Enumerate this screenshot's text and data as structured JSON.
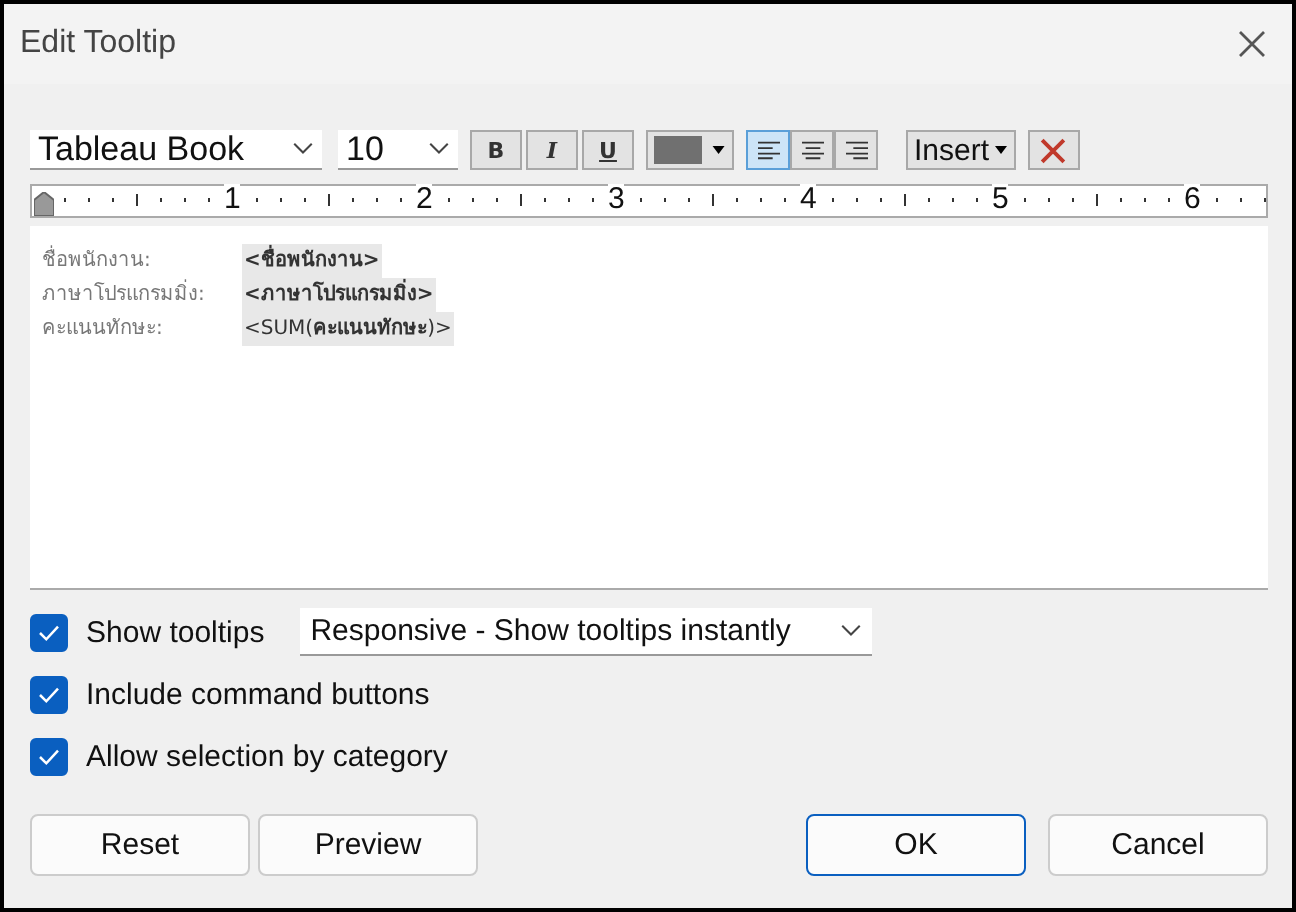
{
  "window": {
    "title": "Edit Tooltip"
  },
  "toolbar": {
    "font": "Tableau Book",
    "size": "10",
    "styles": [
      {
        "label": "B",
        "kind": "bold"
      },
      {
        "label": "I",
        "kind": "italic"
      },
      {
        "label": "U",
        "kind": "underline"
      }
    ],
    "color": "#707070",
    "align": [
      {
        "kind": "left",
        "selected": true
      },
      {
        "kind": "center",
        "selected": false
      },
      {
        "kind": "right",
        "selected": false
      }
    ],
    "insert": "Insert"
  },
  "ruler": {
    "labels": [
      "1",
      "2",
      "3",
      "4",
      "5",
      "6"
    ]
  },
  "lines": [
    {
      "label": "ชื่อพนักงาน:",
      "token": "<ชื่อพนักงาน>",
      "bold": true
    },
    {
      "label": "ภาษาโปรแกรมมิ่ง:",
      "token": "<ภาษาโปรแกรมมิ่ง>",
      "bold": true
    },
    {
      "label": "คะแนนทักษะ:",
      "token": "<SUM(**คะแนนทักษะ**)>",
      "bold": false
    }
  ],
  "options": [
    {
      "label": "Show tooltips",
      "checked": true,
      "dropdown": "Responsive - Show tooltips instantly"
    },
    {
      "label": "Include command buttons",
      "checked": true
    },
    {
      "label": "Allow selection by category",
      "checked": true
    }
  ],
  "buttons": [
    {
      "label": "Reset",
      "primary": false
    },
    {
      "label": "Preview",
      "primary": false
    },
    {
      "label": "OK",
      "primary": true
    },
    {
      "label": "Cancel",
      "primary": false
    }
  ]
}
